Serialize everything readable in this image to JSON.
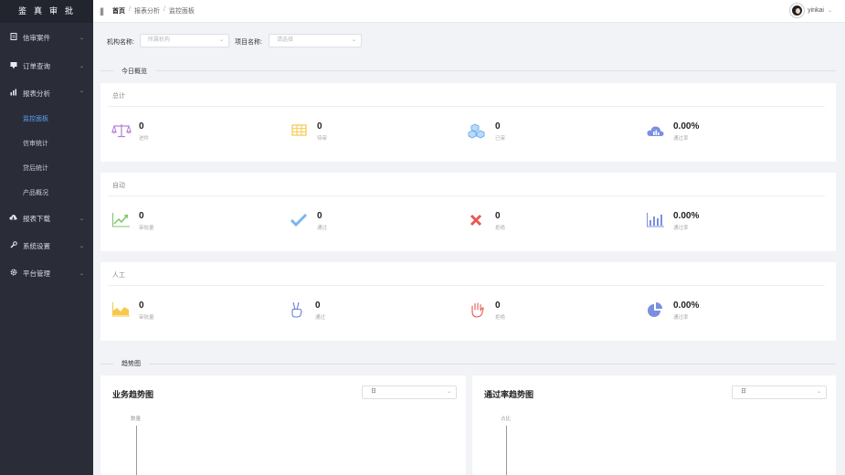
{
  "app": {
    "logo": "鉴真审批"
  },
  "sidebar": {
    "items": [
      {
        "label": "信审案件",
        "icon": "document-icon"
      },
      {
        "label": "订单查询",
        "icon": "monitor-icon"
      },
      {
        "label": "报表分析",
        "icon": "bar-chart-icon"
      },
      {
        "label": "报表下载",
        "icon": "cloud-download-icon"
      },
      {
        "label": "系统设置",
        "icon": "wrench-icon"
      },
      {
        "label": "平台管理",
        "icon": "gear-icon"
      }
    ],
    "sub_items": [
      "监控面板",
      "信审统计",
      "贷后统计",
      "产品概况"
    ]
  },
  "topbar": {
    "breadcrumb": [
      "首页",
      "报表分析",
      "监控面板"
    ],
    "username": "yinkai"
  },
  "filters": {
    "org_label": "机构名称:",
    "org_placeholder": "所属机构",
    "project_label": "项目名称:",
    "project_placeholder": "请选择"
  },
  "overview": {
    "title": "今日概览",
    "cards": [
      {
        "title": "总计",
        "stats": [
          {
            "value": "0",
            "label": "进件",
            "icon": "scales-icon",
            "color": "#b57fd6"
          },
          {
            "value": "0",
            "label": "待审",
            "icon": "table-icon",
            "color": "#f5c94a"
          },
          {
            "value": "0",
            "label": "已审",
            "icon": "boxes-icon",
            "color": "#62a8f2"
          },
          {
            "value": "0.00%",
            "label": "通过率",
            "icon": "cloud-chart-icon",
            "color": "#7b8fe0"
          }
        ]
      },
      {
        "title": "自动",
        "stats": [
          {
            "value": "0",
            "label": "审批量",
            "icon": "trend-line-icon",
            "color": "#7cc66a"
          },
          {
            "value": "0",
            "label": "通过",
            "icon": "check-icon",
            "color": "#7ab6ee"
          },
          {
            "value": "0",
            "label": "拒绝",
            "icon": "cross-icon",
            "color": "#e45a52"
          },
          {
            "value": "0.00%",
            "label": "通过率",
            "icon": "bar-chart-icon",
            "color": "#7b8fe0"
          }
        ]
      },
      {
        "title": "人工",
        "stats": [
          {
            "value": "0",
            "label": "审批量",
            "icon": "area-chart-icon",
            "color": "#f5c94a"
          },
          {
            "value": "0",
            "label": "通过",
            "icon": "victory-hand-icon",
            "color": "#6a7fe0"
          },
          {
            "value": "0",
            "label": "拒绝",
            "icon": "stop-hand-icon",
            "color": "#e45a52"
          },
          {
            "value": "0.00%",
            "label": "通过率",
            "icon": "pie-chart-icon",
            "color": "#7b8fe0"
          }
        ]
      }
    ]
  },
  "trends": {
    "title": "趋势图",
    "charts": [
      {
        "title": "业务趋势图",
        "period": "日",
        "axis_name": "数量"
      },
      {
        "title": "通过率趋势图",
        "period": "日",
        "axis_name": "占比"
      }
    ]
  },
  "colors": {
    "sidebar_bg": "#2a2d37",
    "accent": "#5aa0f5",
    "page_bg": "#f2f3f7"
  }
}
